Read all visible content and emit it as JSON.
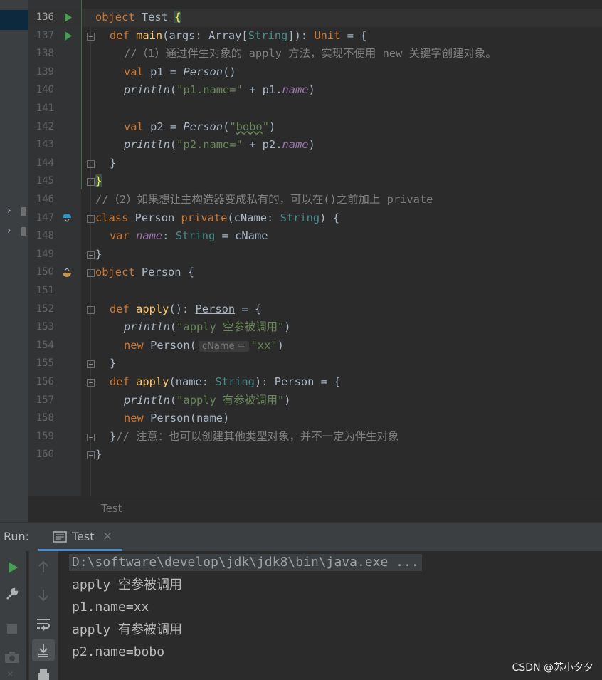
{
  "editor": {
    "lines": [
      {
        "n": "136"
      },
      {
        "n": "137"
      },
      {
        "n": "138"
      },
      {
        "n": "139"
      },
      {
        "n": "140"
      },
      {
        "n": "141"
      },
      {
        "n": "142"
      },
      {
        "n": "143"
      },
      {
        "n": "144"
      },
      {
        "n": "145"
      },
      {
        "n": "146"
      },
      {
        "n": "147"
      },
      {
        "n": "148"
      },
      {
        "n": "149"
      },
      {
        "n": "150"
      },
      {
        "n": "151"
      },
      {
        "n": "152"
      },
      {
        "n": "153"
      },
      {
        "n": "154"
      },
      {
        "n": "155"
      },
      {
        "n": "156"
      },
      {
        "n": "157"
      },
      {
        "n": "158"
      },
      {
        "n": "159"
      },
      {
        "n": "160"
      }
    ],
    "tokens": {
      "kw_object": "object",
      "kw_def": "def",
      "kw_val": "val",
      "kw_class": "class",
      "kw_private": "private",
      "kw_var": "var",
      "kw_new": "new",
      "Test": "Test",
      "main": "main",
      "args": "args",
      "Array": "Array",
      "String": "String",
      "Unit": "Unit",
      "p1": "p1",
      "p2": "p2",
      "Person": "Person",
      "println": "println",
      "name": "name",
      "cName": "cName",
      "apply": "apply",
      "s_p1name": "\"p1.name=\"",
      "s_p2name": "\"p2.name=\"",
      "s_bobo": "bobo",
      "s_xx": "\"xx\"",
      "s_apply_empty": "\"apply 空参被调用\"",
      "s_apply_param": "\"apply 有参被调用\"",
      "comment1": "//（1）通过伴生对象的 apply 方法，实现不使用 new 关键字创建对象。",
      "comment2": "//（2）如果想让主构造器变成私有的，可以在()之前加上 private",
      "comment3": "// 注意：也可以创建其他类型对象，并不一定为伴生对象",
      "hint_cname": "cName ="
    }
  },
  "breadcrumb": {
    "label": "Test"
  },
  "run": {
    "label": "Run:",
    "tab_label": "Test",
    "output": [
      "D:\\software\\develop\\jdk\\jdk8\\bin\\java.exe ...",
      "apply 空参被调用",
      "p1.name=xx",
      "apply 有参被调用",
      "p2.name=bobo"
    ]
  },
  "watermark": "CSDN @苏小夕夕",
  "colors": {
    "bg": "#2b2b2b",
    "keyword": "#cc7832",
    "function": "#ffc66d",
    "string": "#6a8759",
    "comment": "#808080",
    "field": "#9876aa",
    "type": "#4b8b8b",
    "run_icon": "#499c54",
    "tab_underline": "#4a88c7"
  },
  "icons": [
    "run-gutter-icon",
    "override-gutter-icon",
    "implement-gutter-icon",
    "fold-icon",
    "rerun-icon",
    "wrench-icon",
    "stop-icon",
    "camera-icon",
    "up-arrow-icon",
    "down-arrow-icon",
    "soft-wrap-icon",
    "scroll-to-end-icon",
    "print-icon",
    "close-icon",
    "console-tab-icon",
    "expand-arrow-icon"
  ]
}
